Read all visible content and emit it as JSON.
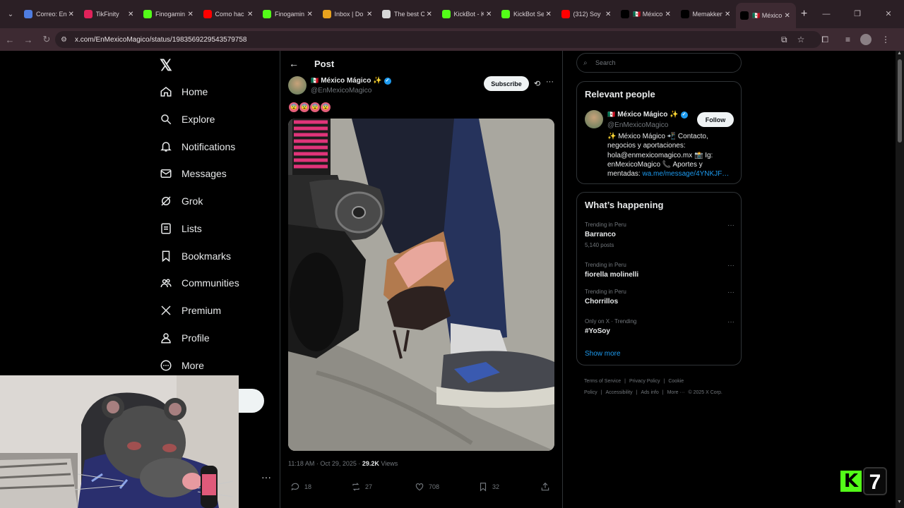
{
  "browser": {
    "tabs": [
      {
        "title": "Correo: En",
        "fav_color": "#4f7de0",
        "active": false
      },
      {
        "title": "TikFinity",
        "fav_color": "#e0225a",
        "active": false
      },
      {
        "title": "Finogamin",
        "fav_color": "#53fc18",
        "active": false
      },
      {
        "title": "Como hac",
        "fav_color": "#ff0000",
        "active": false
      },
      {
        "title": "Finogamin",
        "fav_color": "#53fc18",
        "active": false
      },
      {
        "title": "Inbox | Do",
        "fav_color": "#e8a21e",
        "active": false
      },
      {
        "title": "The best C",
        "fav_color": "#d8d8d8",
        "active": false
      },
      {
        "title": "KickBot - K",
        "fav_color": "#53fc18",
        "active": false
      },
      {
        "title": "KickBot Se",
        "fav_color": "#53fc18",
        "active": false
      },
      {
        "title": "(312) Soy",
        "fav_color": "#ff0000",
        "active": false
      },
      {
        "title": "🇲🇽 México",
        "fav_color": "#000000",
        "active": false
      },
      {
        "title": "Memakken",
        "fav_color": "#000000",
        "active": false
      },
      {
        "title": "🇲🇽 México",
        "fav_color": "#000000",
        "active": true
      }
    ],
    "url": "x.com/EnMexicoMagico/status/1983569229543579758"
  },
  "nav": {
    "logo": "𝕏",
    "items": [
      {
        "label": "Home",
        "icon": "home-icon"
      },
      {
        "label": "Explore",
        "icon": "search-icon"
      },
      {
        "label": "Notifications",
        "icon": "bell-icon"
      },
      {
        "label": "Messages",
        "icon": "mail-icon"
      },
      {
        "label": "Grok",
        "icon": "grok-icon"
      },
      {
        "label": "Lists",
        "icon": "list-icon"
      },
      {
        "label": "Bookmarks",
        "icon": "bookmark-icon"
      },
      {
        "label": "Communities",
        "icon": "people-icon"
      },
      {
        "label": "Premium",
        "icon": "x-icon"
      },
      {
        "label": "Profile",
        "icon": "person-icon"
      },
      {
        "label": "More",
        "icon": "more-circle-icon"
      }
    ]
  },
  "post": {
    "header_title": "Post",
    "author_name": "México Mágico ✨",
    "author_handle": "@EnMexicoMagico",
    "subscribe_label": "Subscribe",
    "text_emojis": [
      "😨",
      "😨",
      "😨",
      "😨"
    ],
    "time": "11:18 AM · Oct 29, 2025 · ",
    "views_count": "29.2K",
    "views_label": " Views",
    "replies": "18",
    "reposts": "27",
    "likes": "708",
    "bookmarks": "32"
  },
  "sidebar": {
    "search_placeholder": "Search",
    "relevant_title": "Relevant people",
    "person": {
      "name": "México Mágico ✨",
      "handle": "@EnMexicoMagico",
      "follow_label": "Follow",
      "bio": "✨ México Mágico 📲 Contacto, negocios y aportaciones: hola@enmexicomagico.mx 📸 Ig: enMexicoMagico 📞 Aportes y mentadas: ",
      "bio_link": "wa.me/message/4YNKJF…"
    },
    "happening_title": "What’s happening",
    "trends": [
      {
        "context": "Trending in Peru",
        "topic": "Barranco",
        "count": "5,140 posts"
      },
      {
        "context": "Trending in Peru",
        "topic": "fiorella molinelli",
        "count": ""
      },
      {
        "context": "Trending in Peru",
        "topic": "Chorrillos",
        "count": ""
      },
      {
        "context": "Only on X · Trending",
        "topic": "#YoSoy",
        "count": ""
      }
    ],
    "show_more": "Show more",
    "footer": [
      "Terms of Service",
      "|",
      "Privacy Policy",
      "|",
      "Cookie Policy",
      "|",
      "Accessibility",
      "|",
      "Ads info",
      "|",
      "More ···",
      "© 2025 X Corp."
    ]
  },
  "overlay": {
    "kick_letter": "K",
    "kick_number": "7"
  },
  "colors": {
    "accent": "#1d9bf0",
    "kick_green": "#53fc18"
  }
}
